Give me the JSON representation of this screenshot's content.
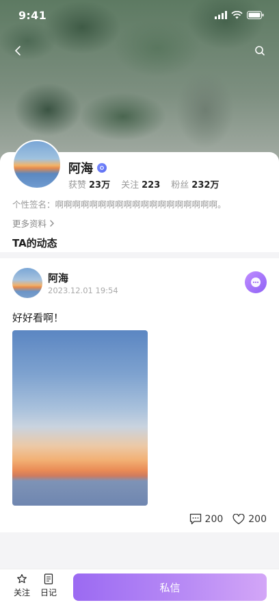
{
  "status_bar": {
    "time": "9:41"
  },
  "profile": {
    "name": "阿海",
    "stats": [
      {
        "label": "获赞",
        "value": "23万"
      },
      {
        "label": "关注",
        "value": "223"
      },
      {
        "label": "粉丝",
        "value": "232万"
      }
    ],
    "signature": "个性签名：啊啊啊啊啊啊啊啊啊啊啊啊啊啊啊啊啊啊啊。",
    "more_info": "更多资料",
    "section_title": "TA的动态"
  },
  "post": {
    "author": "阿海",
    "time": "2023.12.01 19:54",
    "text": "好好看啊！",
    "comments": "200",
    "likes": "200"
  },
  "bottom_bar": {
    "follow_label": "关注",
    "diary_label": "日记",
    "message_label": "私信"
  },
  "colors": {
    "accent": "#9b6af2",
    "verified": "#6a7cf6"
  }
}
